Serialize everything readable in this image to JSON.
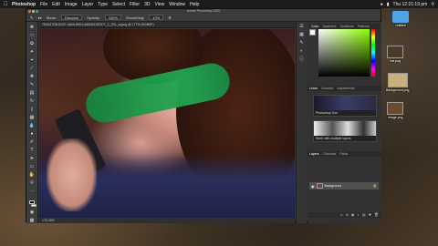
{
  "menubar": {
    "app_name": "Photoshop",
    "items": [
      "File",
      "Edit",
      "Image",
      "Layer",
      "Type",
      "Select",
      "Filter",
      "3D",
      "View",
      "Window",
      "Help"
    ],
    "clock": "Thu 12:21:19 pm"
  },
  "window": {
    "title": "Adobe Photoshop 2020",
    "doc_tab": "7E4A17EB-B21F-4A06-8904-A82084153377_1_201_a.jpeg @ 177% (RGB/8*)",
    "status": "176.38%"
  },
  "options": {
    "mode_label": "Mode:",
    "mode_value": "Dissolve",
    "opacity_label": "Opacity:",
    "opacity_value": "100%",
    "smoothing_label": "Smoothing:",
    "smoothing_value": "10%"
  },
  "panels": {
    "color_tabs": [
      "Color",
      "Swatches",
      "Gradients",
      "Patterns"
    ],
    "learn_tabs": [
      "Learn",
      "Libraries",
      "Adjustments"
    ],
    "learn_cards": [
      "Photoshop Tour",
      "Work with multiple layers"
    ],
    "layers_tabs": [
      "Layers",
      "Channels",
      "Paths"
    ],
    "layer_name": "Background"
  },
  "desktop": {
    "files": [
      "Untitled",
      "hat.png",
      "Background.png",
      "Image.png"
    ]
  }
}
